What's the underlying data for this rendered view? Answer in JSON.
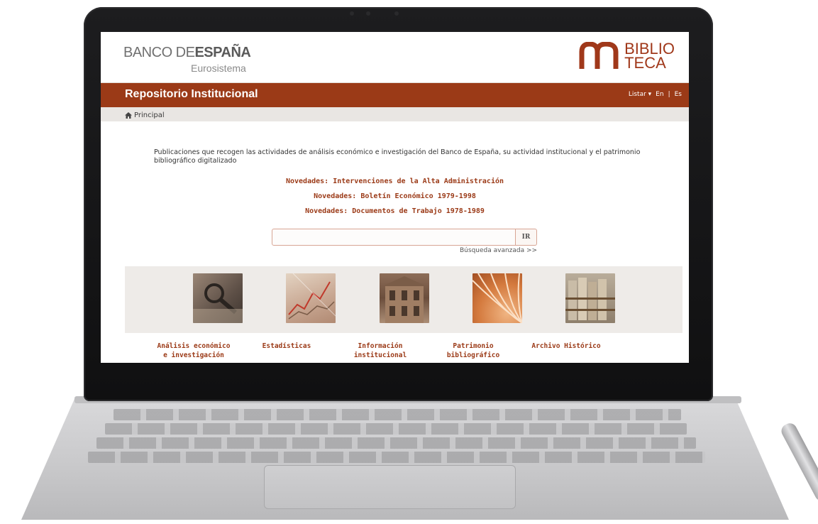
{
  "header": {
    "bde_name_part1": "BANCO DE",
    "bde_name_part2": "ESPAÑA",
    "bde_sub": "Eurosistema",
    "biblio_line1": "BIBLIO",
    "biblio_line2": "TECA"
  },
  "navbar": {
    "title": "Repositorio Institucional",
    "listar": "Listar ▾",
    "lang_en": "En",
    "lang_sep": "|",
    "lang_es": "Es"
  },
  "breadcrumb": {
    "home": "Principal"
  },
  "main": {
    "intro": "Publicaciones que recogen las actividades de análisis económico e investigación del Banco de España, su actividad institucional y el patrimonio bibliográfico digitalizado",
    "news": [
      "Novedades: Intervenciones de la Alta Administración",
      "Novedades: Boletín Económico 1979-1998",
      "Novedades: Documentos de Trabajo 1978-1989"
    ],
    "search": {
      "placeholder": "",
      "button": "IR",
      "advanced": "Búsqueda avanzada >>"
    },
    "categories": [
      {
        "line1": "Análisis económico",
        "line2": "e investigación",
        "icon": "magnifier-photo"
      },
      {
        "line1": "Estadísticas",
        "line2": "",
        "icon": "chart-photo"
      },
      {
        "line1": "Información",
        "line2": "institucional",
        "icon": "building-photo"
      },
      {
        "line1": "Patrimonio",
        "line2": "bibliográfico",
        "icon": "book-photo"
      },
      {
        "line1": "Archivo Histórico",
        "line2": "",
        "icon": "archive-photo"
      }
    ]
  },
  "colors": {
    "accent": "#9b3a17",
    "crumb_bg": "#e9e6e3",
    "gallery_bg": "#eeebe8"
  }
}
